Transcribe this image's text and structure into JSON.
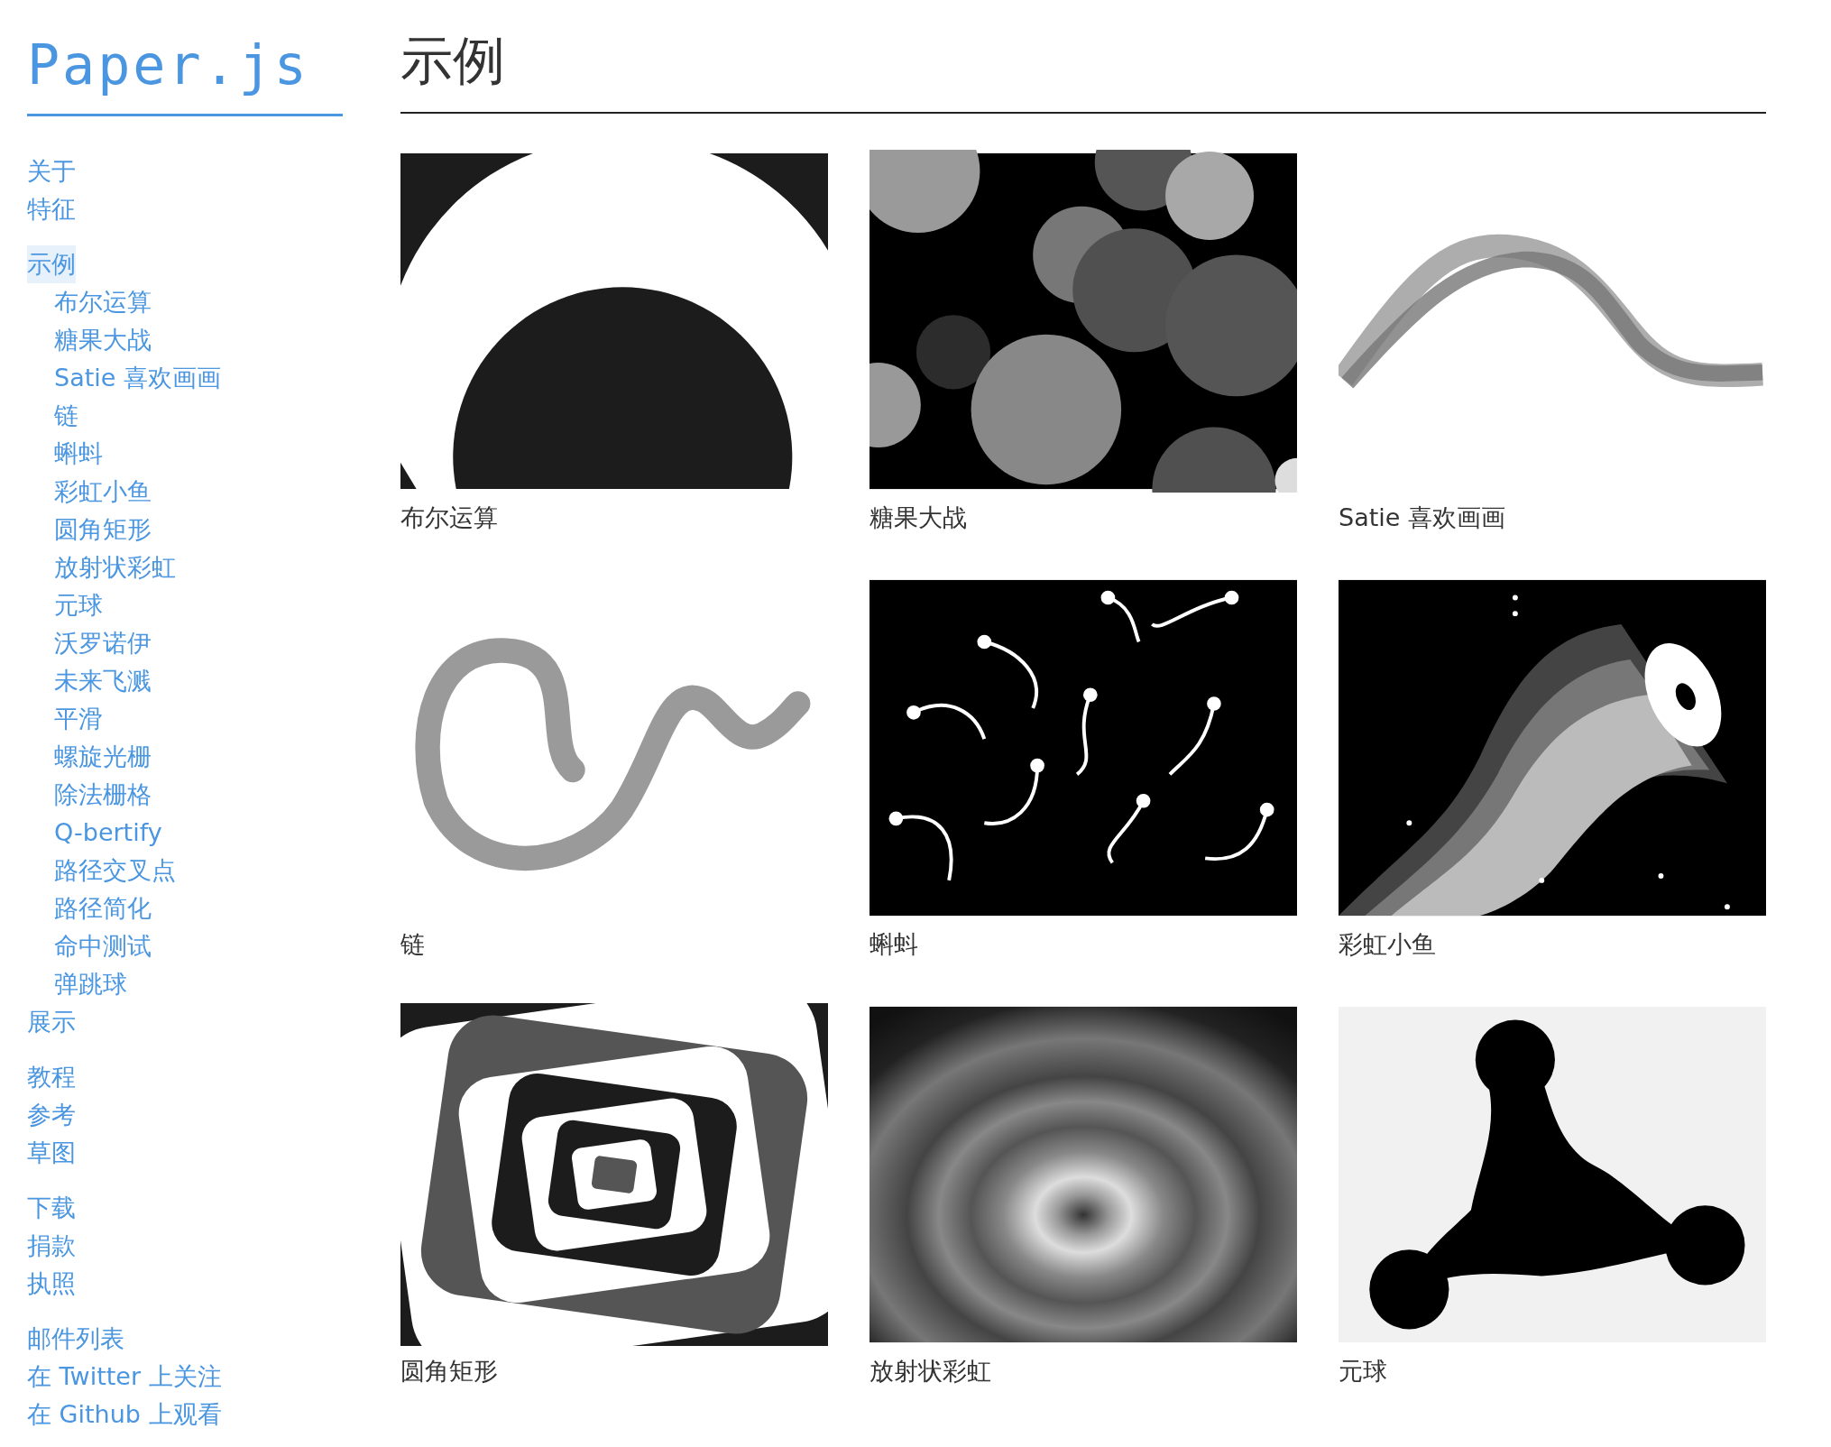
{
  "logo": "Paper.js",
  "sidebar": {
    "groups": [
      {
        "items": [
          {
            "label": "关于",
            "selected": false
          },
          {
            "label": "特征",
            "selected": false
          }
        ]
      },
      {
        "items": [
          {
            "label": "示例",
            "selected": true,
            "children": [
              {
                "label": "布尔运算",
                "selected": false
              },
              {
                "label": "糖果大战",
                "selected": false
              },
              {
                "label": "Satie 喜欢画画",
                "selected": false
              },
              {
                "label": "链",
                "selected": false
              },
              {
                "label": "蝌蚪",
                "selected": false
              },
              {
                "label": "彩虹小鱼",
                "selected": false
              },
              {
                "label": "圆角矩形",
                "selected": false
              },
              {
                "label": "放射状彩虹",
                "selected": false
              },
              {
                "label": "元球",
                "selected": false
              },
              {
                "label": "沃罗诺伊",
                "selected": false
              },
              {
                "label": "未来飞溅",
                "selected": false
              },
              {
                "label": "平滑",
                "selected": false
              },
              {
                "label": "螺旋光栅",
                "selected": false
              },
              {
                "label": "除法栅格",
                "selected": false
              },
              {
                "label": "Q-bertify",
                "selected": false
              },
              {
                "label": "路径交叉点",
                "selected": false
              },
              {
                "label": "路径简化",
                "selected": false
              },
              {
                "label": "命中测试",
                "selected": false
              },
              {
                "label": "弹跳球",
                "selected": false
              }
            ]
          },
          {
            "label": "展示",
            "selected": false
          }
        ]
      },
      {
        "items": [
          {
            "label": "教程",
            "selected": false
          },
          {
            "label": "参考",
            "selected": false
          },
          {
            "label": "草图",
            "selected": false
          }
        ]
      },
      {
        "items": [
          {
            "label": "下载",
            "selected": false
          },
          {
            "label": "捐款",
            "selected": false
          },
          {
            "label": "执照",
            "selected": false
          }
        ]
      },
      {
        "items": [
          {
            "label": "邮件列表",
            "selected": false
          },
          {
            "label": "在 Twitter 上关注",
            "selected": false
          },
          {
            "label": "在 Github 上观看",
            "selected": false
          }
        ]
      }
    ]
  },
  "main": {
    "title": "示例",
    "examples": [
      {
        "caption": "布尔运算"
      },
      {
        "caption": "糖果大战"
      },
      {
        "caption": "Satie 喜欢画画"
      },
      {
        "caption": "链"
      },
      {
        "caption": "蝌蚪"
      },
      {
        "caption": "彩虹小鱼"
      },
      {
        "caption": "圆角矩形"
      },
      {
        "caption": "放射状彩虹"
      },
      {
        "caption": "元球"
      }
    ]
  }
}
